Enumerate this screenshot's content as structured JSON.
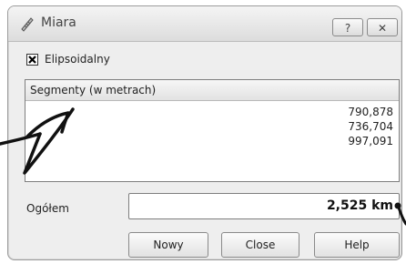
{
  "window": {
    "title": "Miara",
    "help_button": "?",
    "close_button": "✕"
  },
  "ellipsoidal": {
    "label": "Elipsoidalny",
    "checked": true
  },
  "segments": {
    "header": "Segmenty (w metrach)",
    "rows": [
      "790,878",
      "736,704",
      "997,091"
    ]
  },
  "total": {
    "label": "Ogółem",
    "value": "2,525 km"
  },
  "buttons": {
    "new": "Nowy",
    "close": "Close",
    "help": "Help"
  }
}
